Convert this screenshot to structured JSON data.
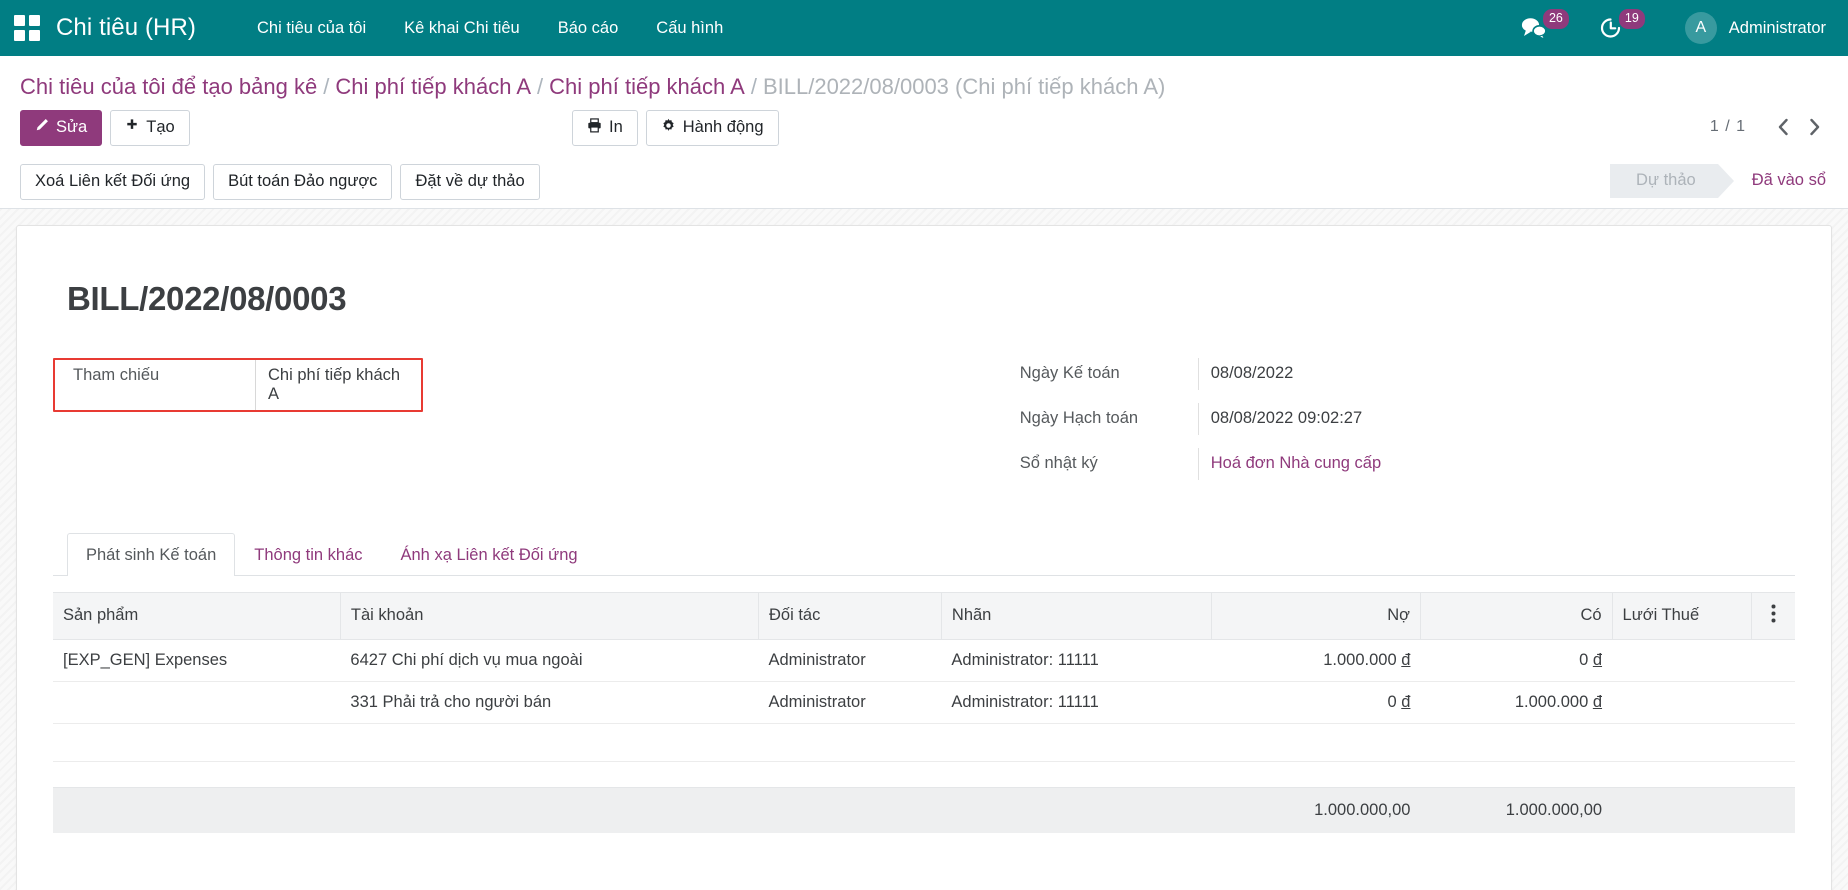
{
  "navbar": {
    "apps_icon": "apps-grid-icon",
    "brand": "Chi tiêu (HR)",
    "menu": [
      {
        "label": "Chi tiêu của tôi"
      },
      {
        "label": "Kê khai Chi tiêu"
      },
      {
        "label": "Báo cáo"
      },
      {
        "label": "Cấu hình"
      }
    ],
    "messages": {
      "icon": "chat-bubble-icon",
      "count": "26"
    },
    "activities": {
      "icon": "clock-activity-icon",
      "count": "19"
    },
    "user": {
      "initial": "A",
      "name": "Administrator"
    },
    "accent_color": "#017e84"
  },
  "breadcrumb": {
    "items": [
      {
        "label": "Chi tiêu của tôi để tạo bảng kê",
        "current": false
      },
      {
        "label": "Chi phí tiếp khách A",
        "current": false
      },
      {
        "label": "Chi phí tiếp khách A",
        "current": false
      },
      {
        "label": "BILL/2022/08/0003 (Chi phí tiếp khách A)",
        "current": true
      }
    ],
    "separator": "/",
    "link_color": "#8f3a7c"
  },
  "toolbar": {
    "edit_label": "Sửa",
    "edit_icon": "pencil-icon",
    "create_label": "Tạo",
    "create_icon": "plus-icon",
    "print_label": "In",
    "print_icon": "printer-icon",
    "action_label": "Hành động",
    "action_icon": "gear-icon",
    "pager_value": "1 / 1",
    "pager_prev_icon": "chevron-left-icon",
    "pager_next_icon": "chevron-right-icon"
  },
  "statusbar_buttons": [
    {
      "label": "Xoá Liên kết Đối ứng"
    },
    {
      "label": "Bút toán Đảo ngược"
    },
    {
      "label": "Đặt về dự thảo"
    }
  ],
  "statusbar": {
    "states": [
      {
        "label": "Dự thảo",
        "active": false
      },
      {
        "label": "Đã vào sổ",
        "active": true
      }
    ],
    "active_color": "#8f3a7c"
  },
  "form": {
    "record_title": "BILL/2022/08/0003",
    "highlight_color": "#e83a33",
    "left_fields": [
      {
        "label": "Tham chiếu",
        "value": "Chi phí tiếp khách A",
        "highlighted": true
      }
    ],
    "right_fields": [
      {
        "label": "Ngày Kế toán",
        "value": "08/08/2022",
        "link": false
      },
      {
        "label": "Ngày Hạch toán",
        "value": "08/08/2022 09:02:27",
        "link": false
      },
      {
        "label": "Sổ nhật ký",
        "value": "Hoá đơn Nhà cung cấp",
        "link": true
      }
    ]
  },
  "notebook": {
    "tabs": [
      {
        "label": "Phát sinh Kế toán",
        "active": true
      },
      {
        "label": "Thông tin khác",
        "active": false
      },
      {
        "label": "Ánh xạ Liên kết Đối ứng",
        "active": false
      }
    ]
  },
  "lines_table": {
    "columns": [
      {
        "label": "Sản phẩm",
        "align": "left"
      },
      {
        "label": "Tài khoản",
        "align": "left"
      },
      {
        "label": "Đối tác",
        "align": "left"
      },
      {
        "label": "Nhãn",
        "align": "left"
      },
      {
        "label": "Nợ",
        "align": "right"
      },
      {
        "label": "Có",
        "align": "right"
      },
      {
        "label": "Lưới Thuế",
        "align": "left"
      }
    ],
    "options_icon": "vertical-dots-icon",
    "rows": [
      {
        "product": "[EXP_GEN] Expenses",
        "account": "6427 Chi phí dịch vụ mua ngoài",
        "partner": "Administrator",
        "label": "Administrator: 11111",
        "debit": "1.000.000",
        "debit_currency": "đ",
        "credit": "0",
        "credit_currency": "đ",
        "tax_grid": ""
      },
      {
        "product": "",
        "account": "331 Phải trả cho người bán",
        "partner": "Administrator",
        "label": "Administrator: 11111",
        "debit": "0",
        "debit_currency": "đ",
        "credit": "1.000.000",
        "credit_currency": "đ",
        "tax_grid": ""
      }
    ],
    "totals": {
      "debit": "1.000.000,00",
      "credit": "1.000.000,00"
    }
  }
}
